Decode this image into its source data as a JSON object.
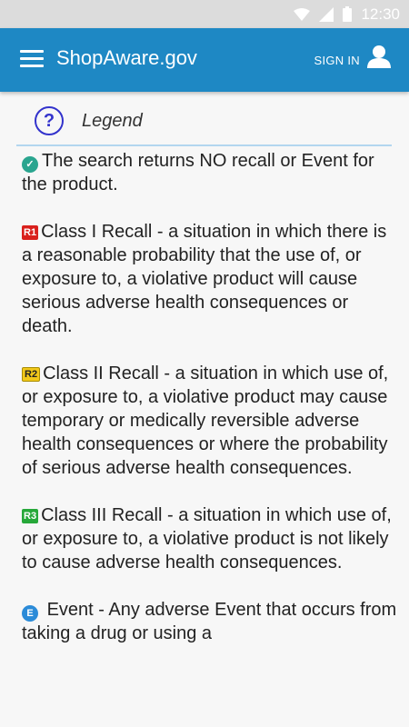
{
  "status_bar": {
    "time": "12:30"
  },
  "app_bar": {
    "title": "ShopAware.gov",
    "sign_in_label": "SIGN IN"
  },
  "legend": {
    "title": "Legend",
    "items": [
      {
        "badge": "",
        "icon": "check-circle-icon",
        "text": "The search returns NO recall or Event for the product."
      },
      {
        "badge": "R1",
        "color": "#d9201c",
        "text": "Class I Recall - a situation in which there is a reasonable probability that the use of, or exposure to, a violative product will cause serious adverse health consequences or death."
      },
      {
        "badge": "R2",
        "color": "#f2c81a",
        "text": "Class II Recall - a situation in which use of, or exposure to, a violative product may cause temporary or medically reversible adverse health consequences or where the probability of serious adverse health consequences."
      },
      {
        "badge": "R3",
        "color": "#27a83a",
        "text": "Class III Recall - a situation in which use of, or exposure to, a violative product is not likely to cause adverse health consequences."
      },
      {
        "badge": "E",
        "color": "#2b8bd8",
        "text": "Event - Any adverse Event that occurs from taking a drug or using a"
      }
    ]
  },
  "colors": {
    "app_bar": "#1e88c4",
    "status_bar": "#dcdcdc",
    "divider": "#b3d6ef",
    "help_icon": "#3333cc"
  }
}
